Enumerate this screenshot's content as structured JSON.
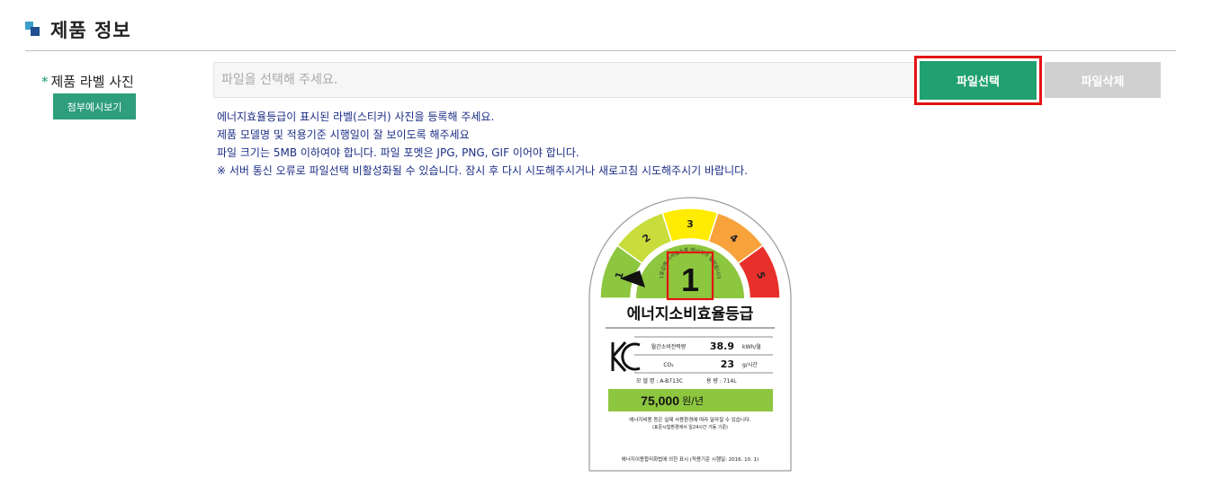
{
  "section": {
    "title": "제품 정보"
  },
  "form": {
    "label_required_mark": "*",
    "label_text": "제품 라벨 사진",
    "example_button": "첨부예시보기",
    "file_placeholder": "파일을 선택해 주세요.",
    "select_button": "파일선택",
    "delete_button": "파일삭제"
  },
  "notes": [
    "에너지효율등급이 표시된 라벨(스티커) 사진을 등록해 주세요.",
    "제품 모델명 및 적용기준 시행일이 잘 보이도록 해주세요",
    "파일 크기는 5MB 이하여야 합니다. 파일 포멧은 JPG, PNG, GIF 이어야 합니다.",
    "※ 서버 통신 오류로 파일선택 비활성화될 수 있습니다. 잠시 후 다시 시도해주시거나 새로고침 시도해주시기 바랍니다."
  ],
  "energy_label": {
    "grades": [
      "1",
      "2",
      "3",
      "4",
      "5"
    ],
    "grade_colors": [
      "#8dc63f",
      "#c8dc3c",
      "#ffec00",
      "#f7a23b",
      "#e8302a"
    ],
    "current_grade": "1",
    "arc_text": "1등급에 가까울수록 에너지가 절약됩니다",
    "title": "에너지소비효율등급",
    "kc_mark": "KC",
    "rows": [
      {
        "label": "월간소비전력량",
        "value": "38.9",
        "unit": "kWh/월"
      },
      {
        "label": "CO₂",
        "value": "23",
        "unit": "g/시간"
      }
    ],
    "model_text": "모 델 명 : A-B713C",
    "capacity_text": "용   량 : 714L",
    "cost": "75,000",
    "cost_unit": "원/년",
    "footnote1": "에너지비용 등은 실제 사용환경에 따라 달라질 수 있습니다.",
    "footnote2": "(표준시험환경에서 일24시간 가동 기준)",
    "legal_text": "에너지이용합리화법에 의한 표시 (적용기준 시행일: 2016. 10. 1)",
    "highlight_color": "#e31414"
  }
}
